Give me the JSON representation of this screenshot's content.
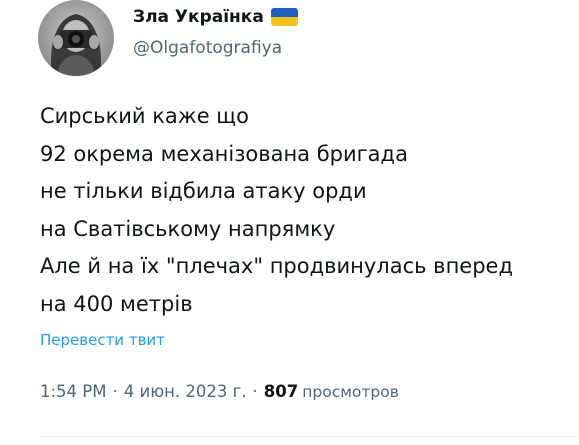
{
  "author": {
    "display_name": "Зла Українка",
    "handle": "@Olgafotografiya",
    "flag_icon": "ukraine-flag-icon",
    "flag_colors": {
      "top": "#1f5fc2",
      "bottom": "#f2c21b"
    }
  },
  "tweet": {
    "lines": [
      "Сирський каже що",
      "92 окрема механізована бригада",
      "не тільки відбила атаку орди",
      "на Сватівському напрямку",
      "Але й на їх \"плечах\" продвинулась вперед",
      "на 400 метрів"
    ],
    "translate_link": "Перевести твит"
  },
  "meta": {
    "time": "1:54 PM",
    "separator": "·",
    "date": "4 июн. 2023 г.",
    "separator2": "·",
    "views_count": "807",
    "views_label": "просмотров"
  },
  "colors": {
    "text": "#0f1419",
    "secondary": "#536471",
    "link": "#1d9bf0"
  }
}
